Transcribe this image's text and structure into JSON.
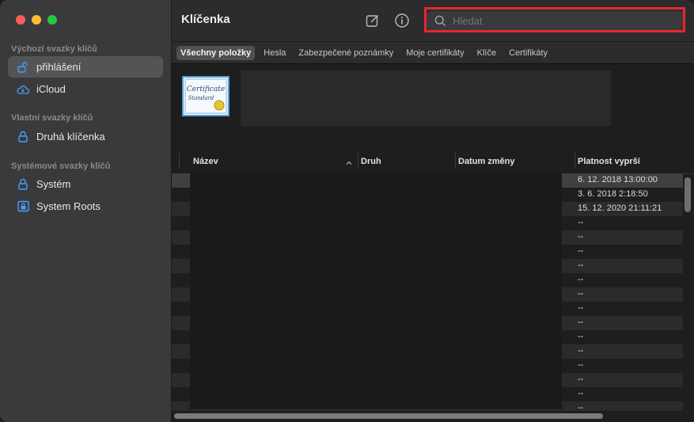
{
  "app": {
    "title": "Klíčenka"
  },
  "sidebar": {
    "sections": [
      {
        "title": "Výchozí svazky klíčů"
      },
      {
        "title": "Vlastní svazky klíčů"
      },
      {
        "title": "Systémové svazky klíčů"
      }
    ],
    "items": [
      {
        "label": "přihlášení",
        "icon": "lock-open-icon",
        "selected": true
      },
      {
        "label": "iCloud",
        "icon": "cloud-icon"
      },
      {
        "label": "Druhá klíčenka",
        "icon": "lock-icon"
      },
      {
        "label": "Systém",
        "icon": "lock-icon"
      },
      {
        "label": "System Roots",
        "icon": "cabinet-lock-icon"
      }
    ]
  },
  "toolbar": {
    "compose_icon": "compose-icon",
    "info_icon": "info-icon"
  },
  "search": {
    "placeholder": "Hledat"
  },
  "filters": [
    "Všechny položky",
    "Hesla",
    "Zabezpečené poznámky",
    "Moje certifikáty",
    "Klíče",
    "Certifikáty"
  ],
  "certificate": {
    "line1": "Certificate",
    "line2": "Standard"
  },
  "columns": {
    "name": "Název",
    "kind": "Druh",
    "modified": "Datum změny",
    "expires": "Platnost vyprší"
  },
  "rows": [
    {
      "expires": "6. 12. 2018 13:00:00"
    },
    {
      "expires": "3. 6. 2018 2:18:50"
    },
    {
      "expires": "15. 12. 2020 21:11:21"
    },
    {
      "expires": "--"
    },
    {
      "expires": "--"
    },
    {
      "expires": "--"
    },
    {
      "expires": "--"
    },
    {
      "expires": "--"
    },
    {
      "expires": "--"
    },
    {
      "expires": "--"
    },
    {
      "expires": "--"
    },
    {
      "expires": "--"
    },
    {
      "expires": "--"
    },
    {
      "expires": "--"
    },
    {
      "expires": "--"
    },
    {
      "expires": "--"
    },
    {
      "expires": "--"
    }
  ],
  "colors": {
    "accent_highlight": "#e8262b",
    "selected_sidebar": "#545457",
    "lock_icon": "#4a9eff"
  }
}
